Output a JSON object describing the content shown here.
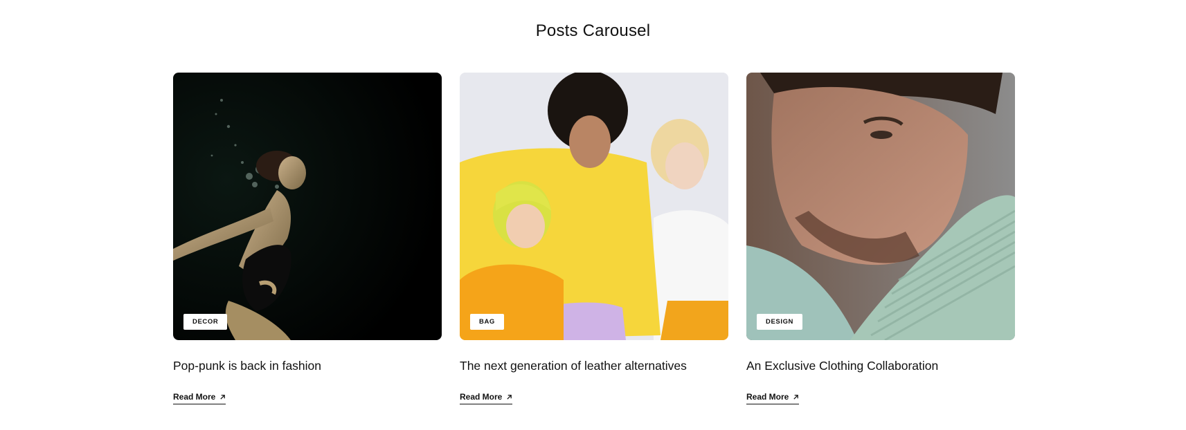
{
  "section": {
    "title": "Posts Carousel"
  },
  "posts": [
    {
      "category": "DECOR",
      "title": "Pop-punk is back in fashion",
      "read_more": "Read More",
      "image": "underwater-woman-photo"
    },
    {
      "category": "BAG",
      "title": "The next generation of leather alternatives",
      "read_more": "Read More",
      "image": "three-colorful-kids-photo"
    },
    {
      "category": "DESIGN",
      "title": "An Exclusive Clothing Collaboration",
      "read_more": "Read More",
      "image": "man-closeup-portrait-photo"
    }
  ],
  "icons": {
    "read_more": "arrow-up-right-icon"
  },
  "colors": {
    "text": "#111111",
    "background": "#ffffff",
    "badge_bg": "#ffffff"
  }
}
